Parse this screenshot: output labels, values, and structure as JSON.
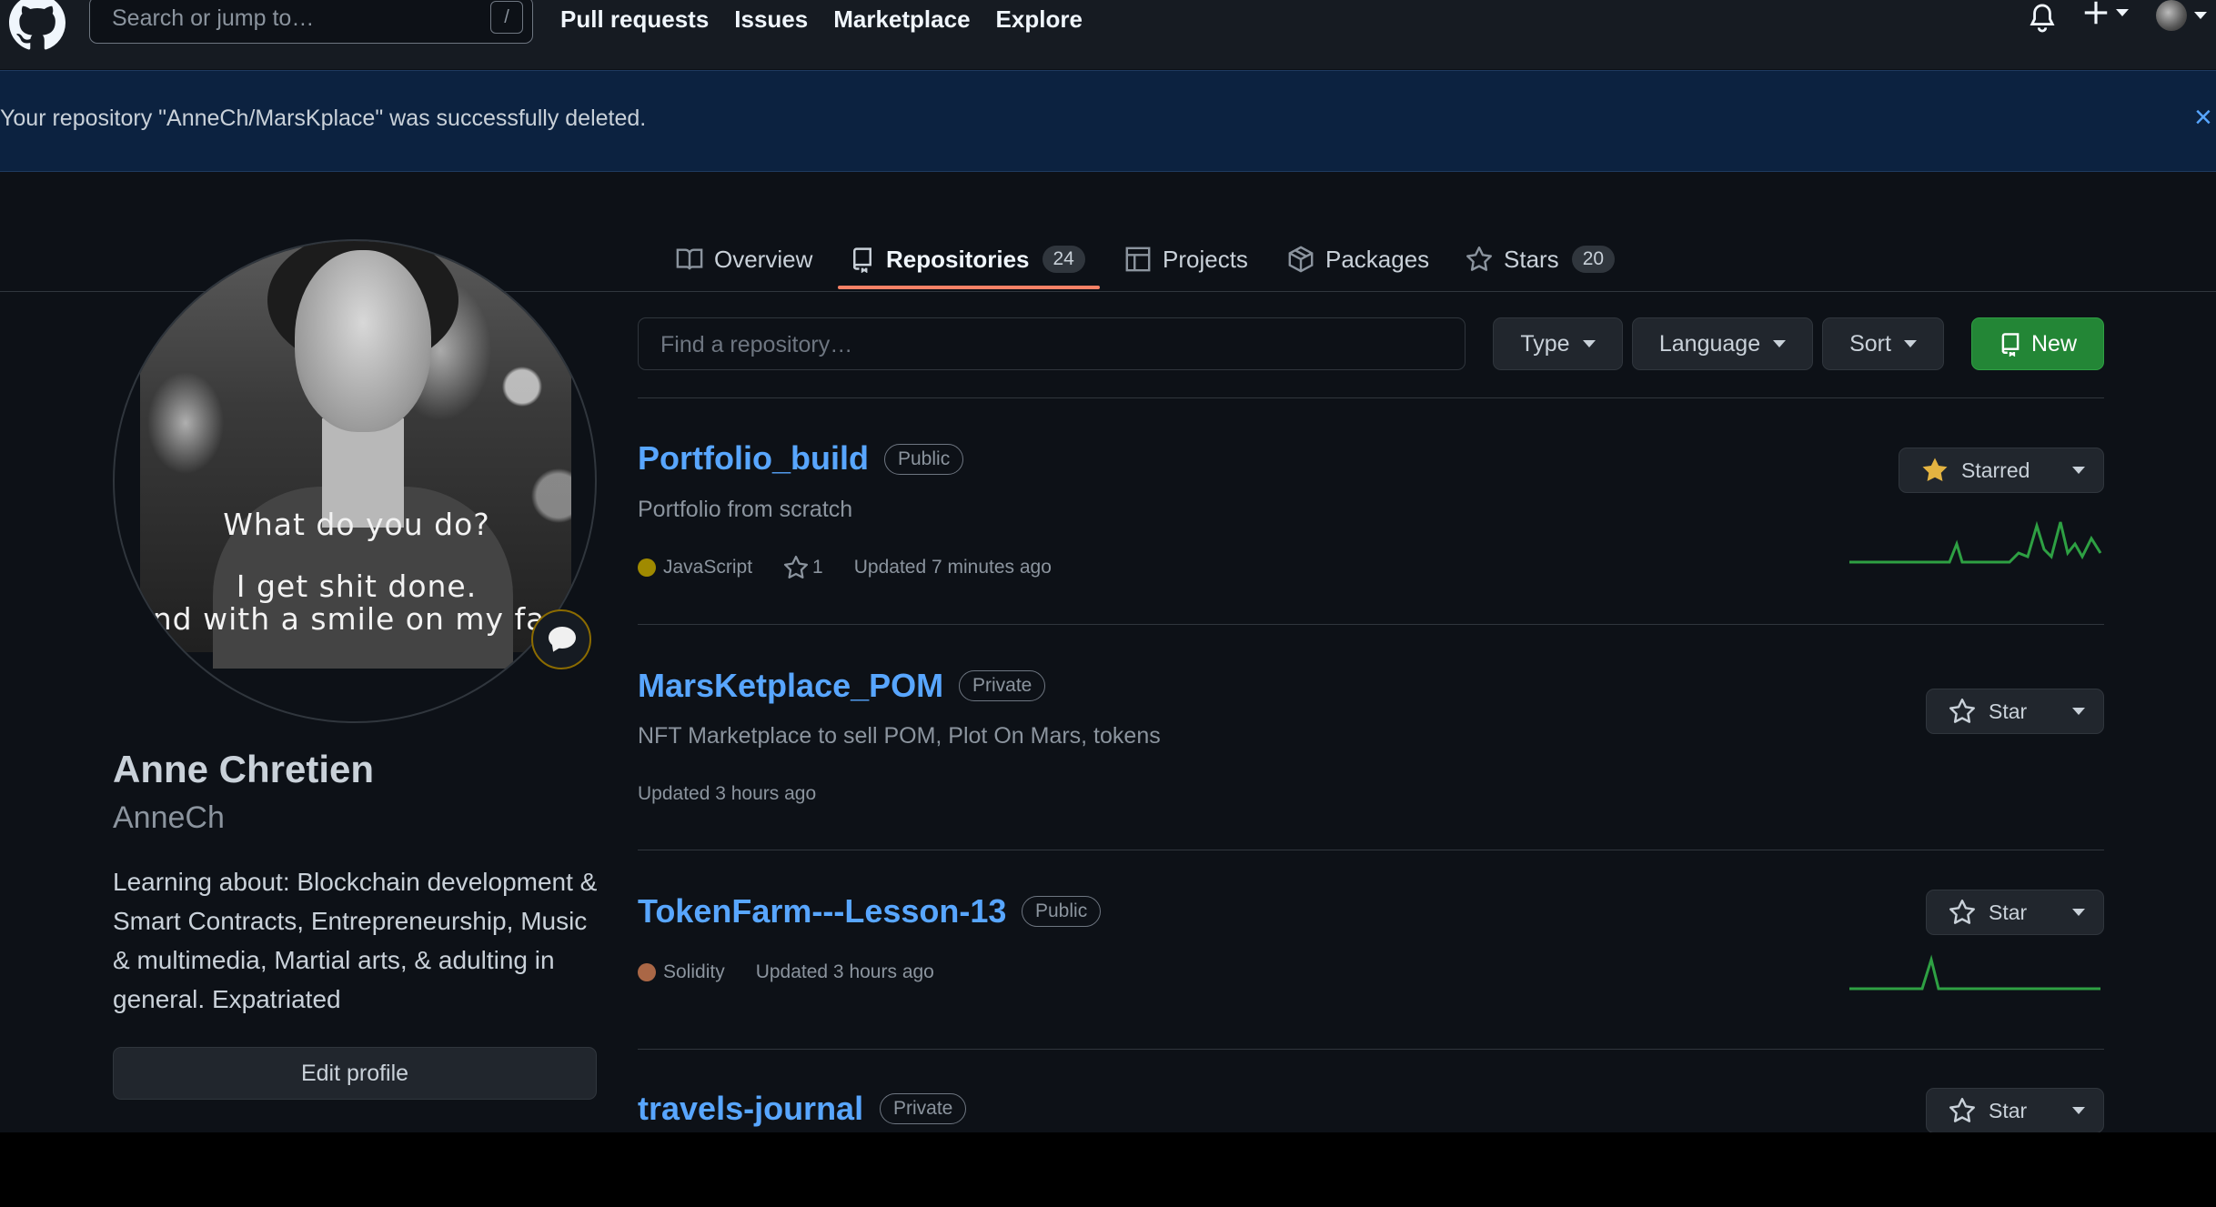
{
  "header": {
    "search_placeholder": "Search or jump to…",
    "search_shortcut": "/",
    "nav": [
      "Pull requests",
      "Issues",
      "Marketplace",
      "Explore"
    ]
  },
  "flash": {
    "message": "Your repository \"AnneCh/MarsKplace\" was successfully deleted.",
    "close": "×"
  },
  "tabs": [
    {
      "label": "Overview",
      "icon": "book-icon"
    },
    {
      "label": "Repositories",
      "counter": "24",
      "icon": "repo-icon",
      "selected": true
    },
    {
      "label": "Projects",
      "icon": "table-icon"
    },
    {
      "label": "Packages",
      "icon": "package-icon"
    },
    {
      "label": "Stars",
      "counter": "20",
      "icon": "star-icon"
    }
  ],
  "profile": {
    "avatar_text": [
      "What do you do?",
      "I get shit done.",
      "And with a smile on my face"
    ],
    "full_name": "Anne Chretien",
    "login": "AnneCh",
    "bio": "Learning about: Blockchain development & Smart Contracts, Entrepreneurship, Music & multimedia, Martial arts, & adulting in general. Expatriated",
    "edit_label": "Edit profile"
  },
  "filters": {
    "find_placeholder": "Find a repository…",
    "type": "Type",
    "language": "Language",
    "sort": "Sort",
    "new": "New"
  },
  "repos": [
    {
      "name": "Portfolio_build",
      "visibility": "Public",
      "description": "Portfolio from scratch",
      "language": "JavaScript",
      "language_color": "#a08a00",
      "stars": "1",
      "updated": "Updated 7 minutes ago",
      "star_label": "Starred",
      "starred": true
    },
    {
      "name": "MarsKetplace_POM",
      "visibility": "Private",
      "description": "NFT Marketplace to sell POM, Plot On Mars, tokens",
      "updated": "Updated 3 hours ago",
      "star_label": "Star",
      "starred": false
    },
    {
      "name": "TokenFarm---Lesson-13",
      "visibility": "Public",
      "language": "Solidity",
      "language_color": "#aa6746",
      "updated": "Updated 3 hours ago",
      "star_label": "Star",
      "starred": false
    },
    {
      "name": "travels-journal",
      "visibility": "Private",
      "star_label": "Star",
      "starred": false
    }
  ],
  "colors": {
    "background": "#0d1117",
    "link": "#58a6ff",
    "accent_underline": "#f78166",
    "primary_button": "#238636",
    "starred_icon": "#e3b341",
    "sparkline": "#2ea043"
  }
}
